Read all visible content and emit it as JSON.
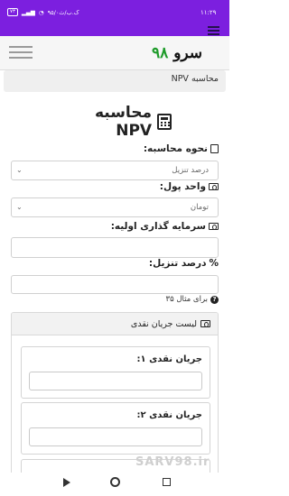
{
  "status_bar": {
    "time": "۱۱:۲۹",
    "data_rate": "۹۵/۰ک.ب/ث",
    "battery": "۷۳"
  },
  "navbar": {
    "brand_name": "سرو",
    "brand_number": "۹۸"
  },
  "breadcrumb": {
    "current": "محاسبه NPV"
  },
  "page": {
    "title": "محاسبه NPV"
  },
  "form": {
    "calc_method": {
      "label": "نحوه محاسبه:",
      "value": "درصد تنزیل"
    },
    "currency": {
      "label": "واحد پول:",
      "value": "تومان"
    },
    "initial_investment": {
      "label": "سرمایه گذاری اولیه:",
      "value": ""
    },
    "discount_rate": {
      "label": "درصد تنزیل:",
      "value": "",
      "help": "برای مثال ۳۵"
    }
  },
  "cash_flows": {
    "header": "لیست جریان نقدی",
    "items": [
      {
        "label": "جریان نقدی ۱:",
        "value": ""
      },
      {
        "label": "جریان نقدی ۲:",
        "value": ""
      }
    ]
  },
  "watermark": "SARV98.ir",
  "icons": {
    "menu": "hamburger-icon",
    "calculator": "calculator-icon",
    "money": "money-bill-icon",
    "question": "question-circle-icon"
  },
  "colors": {
    "status_bar": "#7c1fdf",
    "brand_accent": "#1e9b2a"
  }
}
